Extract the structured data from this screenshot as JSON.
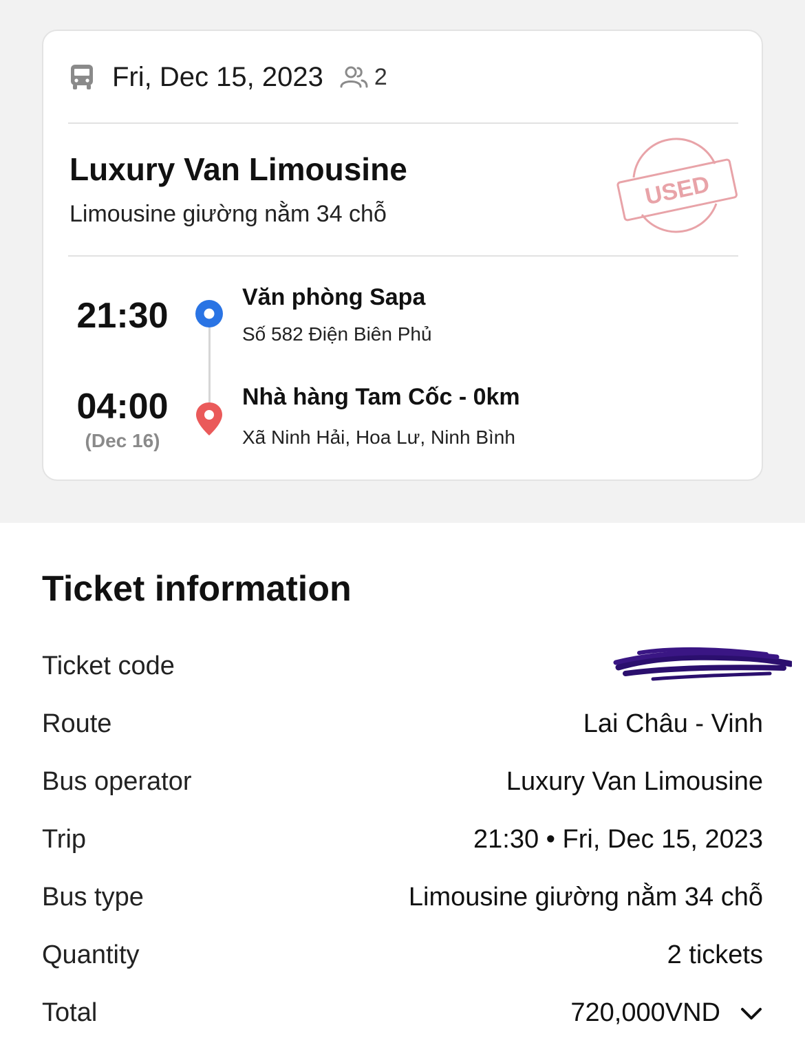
{
  "header": {
    "date": "Fri, Dec 15, 2023",
    "passenger_count": "2"
  },
  "operator": {
    "name": "Luxury Van Limousine",
    "bus_type": "Limousine giường nằm 34 chỗ"
  },
  "stamp": {
    "label": "USED",
    "color": "#e8a3a8"
  },
  "pickup": {
    "time": "21:30",
    "name": "Văn phòng Sapa",
    "address": "Số 582 Điện Biên Phủ",
    "icon": "pickup-dot-icon",
    "color": "#2a74e4"
  },
  "dropoff": {
    "time": "04:00",
    "date_note": "(Dec 16)",
    "name": "Nhà hàng Tam Cốc - 0km",
    "address": "Xã Ninh Hải, Hoa Lư, Ninh Bình",
    "icon": "location-pin-icon",
    "color": "#ea5a5a"
  },
  "ticket_info": {
    "title": "Ticket information",
    "rows": [
      {
        "label": "Ticket code",
        "value": ""
      },
      {
        "label": "Route",
        "value": "Lai Châu - Vinh"
      },
      {
        "label": "Bus operator",
        "value": "Luxury Van Limousine"
      },
      {
        "label": "Trip",
        "value": "21:30 • Fri, Dec 15, 2023"
      },
      {
        "label": "Bus type",
        "value": "Limousine giường nằm 34 chỗ"
      },
      {
        "label": "Quantity",
        "value": "2 tickets"
      },
      {
        "label": "Total",
        "value": "720,000VND"
      }
    ]
  }
}
